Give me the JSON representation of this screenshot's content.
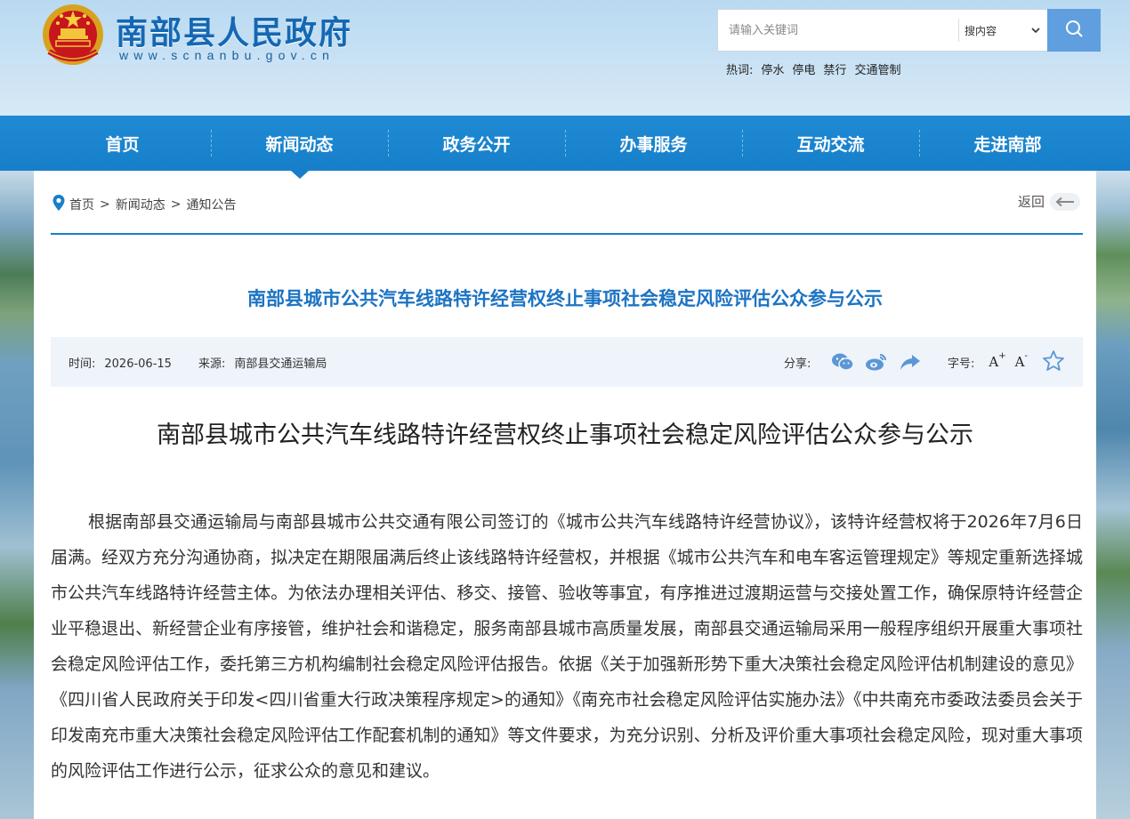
{
  "header": {
    "site_name": "南部县人民政府",
    "site_url": "www.scnanbu.gov.cn",
    "search": {
      "placeholder": "请输入关键词",
      "scope": "搜内容"
    },
    "hot": {
      "label": "热词:",
      "items": [
        "停水",
        "停电",
        "禁行",
        "交通管制"
      ]
    }
  },
  "nav": {
    "items": [
      "首页",
      "新闻动态",
      "政务公开",
      "办事服务",
      "互动交流",
      "走进南部"
    ],
    "active": "新闻动态"
  },
  "breadcrumb": {
    "items": [
      "首页",
      "新闻动态",
      "通知公告"
    ],
    "separator": ">",
    "back_label": "返回"
  },
  "article": {
    "top_title": "南部县城市公共汽车线路特许经营权终止事项社会稳定风险评估公众参与公示",
    "meta": {
      "time_label": "时间:",
      "time": "2026-06-15",
      "source_label": "来源:",
      "source": "南部县交通运输局",
      "share_label": "分享:",
      "font_label": "字号:",
      "font_plus": "A",
      "font_minus": "A"
    },
    "title": "南部县城市公共汽车线路特许经营权终止事项社会稳定风险评估公众参与公示",
    "body": "根据南部县交通运输局与南部县城市公共交通有限公司签订的《城市公共汽车线路特许经营协议》，该特许经营权将于2026年7月6日届满。经双方充分沟通协商，拟决定在期限届满后终止该线路特许经营权，并根据《城市公共汽车和电车客运管理规定》等规定重新选择城市公共汽车线路特许经营主体。为依法办理相关评估、移交、接管、验收等事宜，有序推进过渡期运营与交接处置工作，确保原特许经营企业平稳退出、新经营企业有序接管，维护社会和谐稳定，服务南部县城市高质量发展，南部县交通运输局采用一般程序组织开展重大事项社会稳定风险评估工作，委托第三方机构编制社会稳定风险评估报告。依据《关于加强新形势下重大决策社会稳定风险评估机制建设的意见》《四川省人民政府关于印发<四川省重大行政决策程序规定>的通知》《南充市社会稳定风险评估实施办法》《中共南充市委政法委员会关于印发南充市重大决策社会稳定风险评估工作配套机制的通知》等文件要求，为充分识别、分析及评价重大事项社会稳定风险，现对重大事项的风险评估工作进行公示，征求公众的意见和建议。"
  },
  "colors": {
    "brand_blue": "#1c86cf",
    "title_blue": "#1d74c3",
    "search_button": "#5f9fe0",
    "meta_bg": "#eef4fa"
  }
}
